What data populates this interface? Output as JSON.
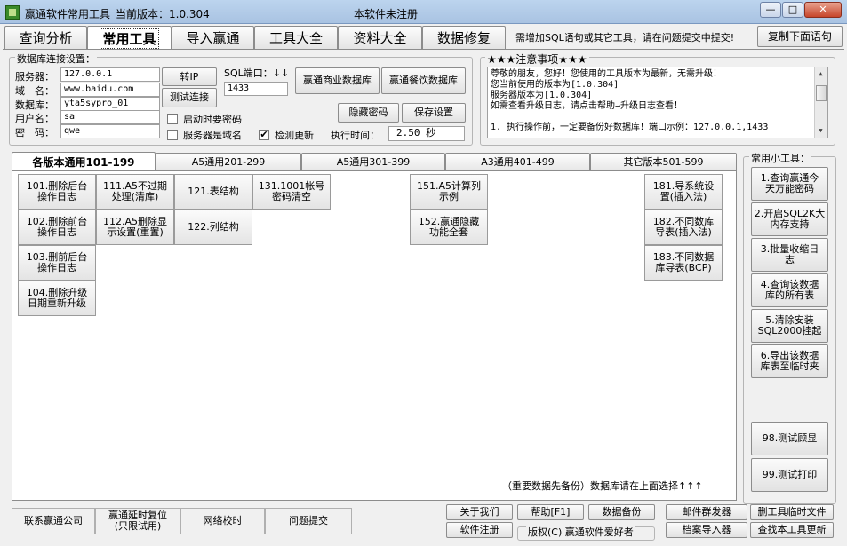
{
  "window": {
    "title": "赢通软件常用工具",
    "version_label": "当前版本：1.0.304",
    "reg_status": "本软件未注册",
    "min": "—",
    "max": "□",
    "close": "✕"
  },
  "main_tabs": [
    "查询分析",
    "常用工具",
    "导入赢通",
    "工具大全",
    "资料大全",
    "数据修复"
  ],
  "hint_text": "需增加SQL语句或其它工具，请在问题提交中提交!",
  "copy_button": "复制下面语句",
  "db": {
    "group_title": "数据库连接设置：",
    "server_label": "服务器：",
    "server_value": "127.0.0.1",
    "domain_label": "域　名：",
    "domain_value": "www.baidu.com",
    "database_label": "数据库：",
    "database_value": "yta5sypro_01",
    "user_label": "用户名：",
    "user_value": "sa",
    "password_label": "密　码：",
    "password_value": "qwe",
    "to_ip": "转IP",
    "test_conn": "测试连接",
    "port_label": "SQL端口：↓↓",
    "port_value": "1433",
    "btn_commerce": "赢通商业数据库",
    "btn_catering": "赢通餐饮数据库",
    "btn_hide_pwd": "隐藏密码",
    "btn_save": "保存设置",
    "chk_pwd_on_start": "启动时要密码",
    "chk_is_domain": "服务器是域名",
    "chk_check_update": "检测更新",
    "exec_time_label": "执行时间：",
    "exec_time_value": "2.50 秒",
    "chk_check_update_mark": "✔"
  },
  "notice": {
    "title": "★★★注意事项★★★",
    "lines": [
      "尊敬的朋友，您好！您使用的工具版本为最新，无需升级！",
      "您当前使用的版本为[1.0.304]",
      "服务器版本为[1.0.304]",
      "如需查看升级日志，请点击帮助→升级日志查看！",
      "",
      "1. 执行操作前，一定要备份好数据库！端口示例：127.0.0.1,1433"
    ]
  },
  "sub_tabs": [
    "各版本通用101-199",
    "A5通用201-299",
    "A5通用301-399",
    "A3通用401-499",
    "其它版本501-599"
  ],
  "tool_buttons": {
    "b101": "101.删除后台\n操作日志",
    "b102": "102.删除前台\n操作日志",
    "b103": "103.删前后台\n操作日志",
    "b104": "104.删除升级\n日期重新升级",
    "b111": "111.A5不过期\n处理(清库)",
    "b112": "112.A5删除显\n示设置(重置)",
    "b121": "121.表结构",
    "b122": "122.列结构",
    "b131": "131.1001帐号\n密码清空",
    "b151": "151.A5计算列\n示例",
    "b152": "152.赢通隐藏\n功能全套",
    "b181": "181.导系统设\n置(插入法)",
    "b182": "182.不同数库\n导表(插入法)",
    "b183": "183.不同数据\n库导表(BCP)"
  },
  "panel_note": "（重要数据先备份）数据库请在上面选择↑↑↑",
  "side_tools": {
    "title": "常用小工具：",
    "items": [
      "1.查询赢通今\n天万能密码",
      "2.开启SQL2K大\n内存支持",
      "3.批量收缩日\n志",
      "4.查询该数据\n库的所有表",
      "5.清除安装\nSQL2000挂起",
      "6.导出该数据\n库表至临时夹"
    ],
    "test_lookup": "98.测试顾显",
    "test_print": "99.测试打印"
  },
  "bottom": {
    "contact": "联系赢通公司",
    "delay_reset": "赢通延时复位\n(只限试用)",
    "net_time": "网络校时",
    "submit_issue": "问题提交",
    "about": "关于我们",
    "help": "帮助[F1]",
    "backup": "数据备份",
    "mail": "邮件群发器",
    "del_temp": "删工具临时文件",
    "register": "软件注册",
    "copyright": "版权(C) 赢通软件爱好者",
    "archive_import": "档案导入器",
    "find_update": "查找本工具更新"
  },
  "colors": {
    "title_bar": "#bcd4ee",
    "app_icon": "#3a8a2a"
  }
}
